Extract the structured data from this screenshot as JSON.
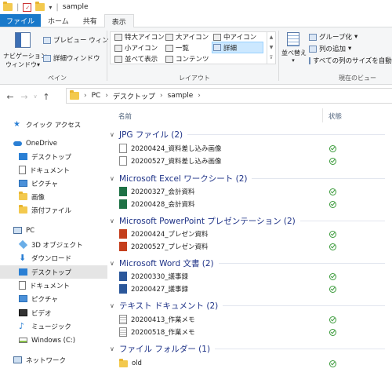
{
  "window": {
    "title": "sample"
  },
  "tabs": {
    "file": "ファイル",
    "home": "ホーム",
    "share": "共有",
    "view": "表示"
  },
  "ribbon": {
    "nav_pane": "ナビゲーション\nウィンドウ",
    "nav_pane_l1": "ナビゲーション",
    "nav_pane_l2": "ウィンドウ",
    "preview": "プレビュー ウィンドウ",
    "details_pane": "詳細ウィンドウ",
    "pane_group": "ペイン",
    "layout": {
      "xl_icons": "特大アイコン",
      "large_icons": "大アイコン",
      "medium_icons": "中アイコン",
      "small_icons": "小アイコン",
      "list": "一覧",
      "details": "詳細",
      "tiles": "並べて表示",
      "content": "コンテンツ"
    },
    "layout_group": "レイアウト",
    "sort": "並べ替え",
    "group_by": "グループ化",
    "add_columns": "列の追加",
    "size_all": "すべての列のサイズを自動的",
    "current_view_group": "現在のビュー"
  },
  "address": {
    "crumbs": [
      "PC",
      "デスクトップ",
      "sample"
    ]
  },
  "sidebar": {
    "quick_access": "クイック アクセス",
    "onedrive": "OneDrive",
    "od_items": [
      "デスクトップ",
      "ドキュメント",
      "ピクチャ",
      "画像",
      "添付ファイル"
    ],
    "pc": "PC",
    "pc_items": [
      "3D オブジェクト",
      "ダウンロード",
      "デスクトップ",
      "ドキュメント",
      "ピクチャ",
      "ビデオ",
      "ミュージック",
      "Windows (C:)"
    ],
    "network": "ネットワーク"
  },
  "columns": {
    "name": "名前",
    "status": "状態"
  },
  "groups": [
    {
      "title": "JPG ファイル (2)",
      "files": [
        "20200424_資料差し込み画像",
        "20200527_資料差し込み画像"
      ]
    },
    {
      "title": "Microsoft Excel ワークシート (2)",
      "files": [
        "20200327_会計資料",
        "20200428_会計資料"
      ]
    },
    {
      "title": "Microsoft PowerPoint プレゼンテーション (2)",
      "files": [
        "20200424_プレゼン資料",
        "20200527_プレゼン資料"
      ]
    },
    {
      "title": "Microsoft Word 文書 (2)",
      "files": [
        "20200330_議事録",
        "20200427_議事録"
      ]
    },
    {
      "title": "テキスト ドキュメント (2)",
      "files": [
        "20200413_作業メモ",
        "20200518_作業メモ"
      ]
    },
    {
      "title": "ファイル フォルダー (1)",
      "files": [
        "old"
      ]
    }
  ],
  "colors": {
    "accent": "#1979ca",
    "group_title": "#1e3287",
    "status_ok": "#3a9a3a",
    "excel": "#1e7145",
    "ppt": "#c43e1c",
    "word": "#2b579a"
  }
}
